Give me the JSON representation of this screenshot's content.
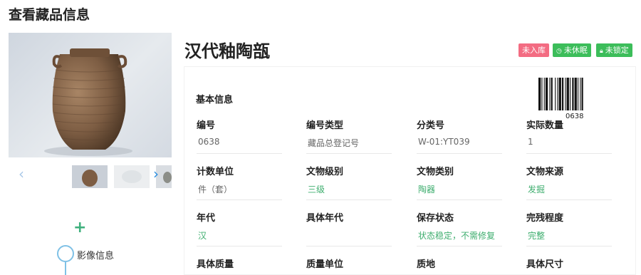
{
  "page": {
    "title": "查看藏品信息"
  },
  "item": {
    "name": "汉代釉陶瓿"
  },
  "badges": [
    {
      "label": "未入库",
      "icon": ""
    },
    {
      "label": "未休眠",
      "icon": "clock-icon"
    },
    {
      "label": "未锁定",
      "icon": "lock-icon"
    }
  ],
  "section": {
    "title": "基本信息"
  },
  "barcode": {
    "text": "0638"
  },
  "sidebar": {
    "image_info_label": "影像信息",
    "add_symbol": "+"
  },
  "fields": [
    {
      "label": "编号",
      "value": "0638",
      "style": "gray"
    },
    {
      "label": "编号类型",
      "value": "藏品总登记号",
      "style": "gray"
    },
    {
      "label": "分类号",
      "value": "W-01:YT039",
      "style": "gray"
    },
    {
      "label": "实际数量",
      "value": "1",
      "style": "gray"
    },
    {
      "label": "计数单位",
      "value": "件（套）",
      "style": "gray"
    },
    {
      "label": "文物级别",
      "value": "三级",
      "style": "green"
    },
    {
      "label": "文物类别",
      "value": "陶器",
      "style": "green"
    },
    {
      "label": "文物来源",
      "value": "发掘",
      "style": "green"
    },
    {
      "label": "年代",
      "value": "汉",
      "style": "green"
    },
    {
      "label": "具体年代",
      "value": "",
      "style": "gray"
    },
    {
      "label": "保存状态",
      "value": "状态稳定，不需修复",
      "style": "green"
    },
    {
      "label": "完残程度",
      "value": "完整",
      "style": "green"
    },
    {
      "label": "具体质量",
      "value": "",
      "style": "gray"
    },
    {
      "label": "质量单位",
      "value": "",
      "style": "gray"
    },
    {
      "label": "质地",
      "value": "",
      "style": "gray"
    },
    {
      "label": "具体尺寸",
      "value": "",
      "style": "gray"
    }
  ],
  "colors": {
    "accent_green": "#3fae6f",
    "badge_red": "#f36c82",
    "badge_green": "#3cbd5a",
    "link_blue": "#2d8fe0"
  }
}
